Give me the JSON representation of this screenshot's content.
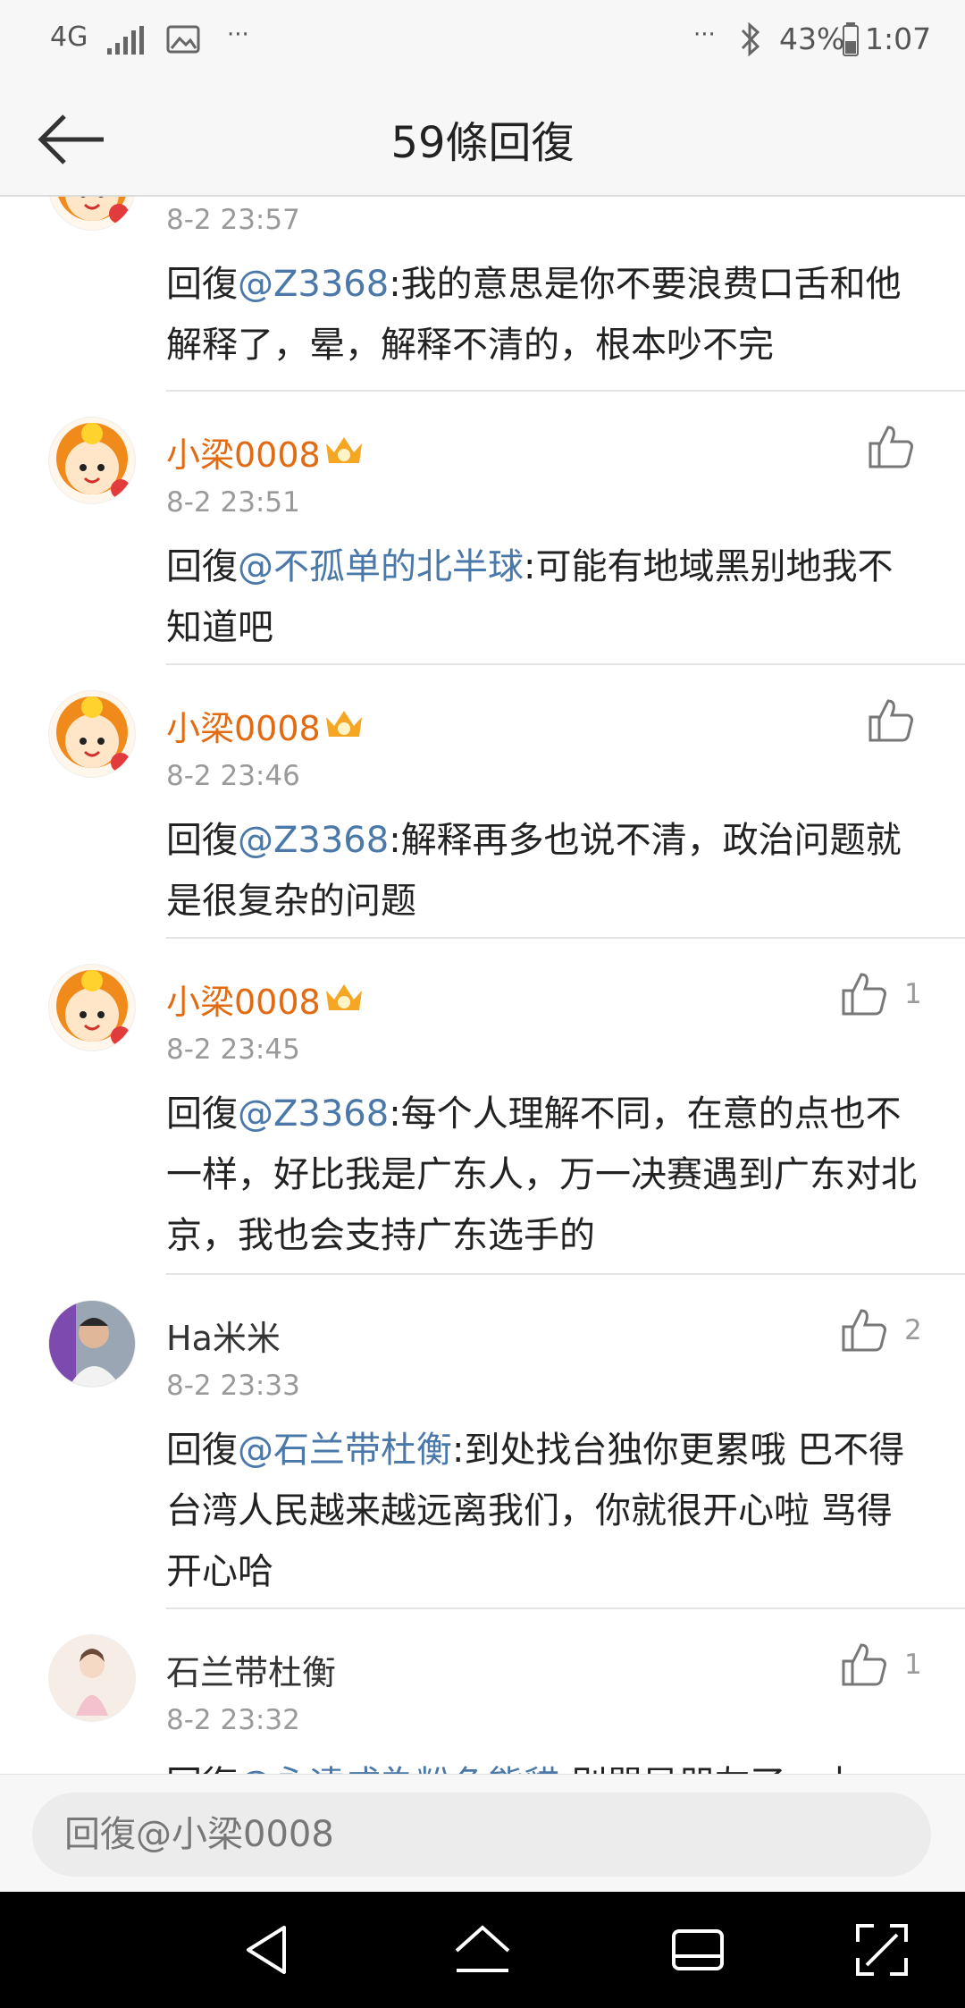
{
  "status_bar": {
    "network": "4G",
    "more_left": "···",
    "more_right": "···",
    "battery": "43%",
    "time": "1:07"
  },
  "header": {
    "title": "59條回復"
  },
  "comments": [
    {
      "username": "",
      "time": "8-2 23:57",
      "prefix": "回復",
      "mention": "@Z3368",
      "body": ":我的意思是你不要浪费口舌和他解释了，晕，解释不清的，根本吵不完",
      "likes": ""
    },
    {
      "username": "小梁0008",
      "time": "8-2 23:51",
      "prefix": "回復",
      "mention": "@不孤单的北半球",
      "body": ":可能有地域黑别地我不知道吧",
      "likes": ""
    },
    {
      "username": "小梁0008",
      "time": "8-2 23:46",
      "prefix": "回復",
      "mention": "@Z3368",
      "body": ":解释再多也说不清，政治问题就是很复杂的问题",
      "likes": ""
    },
    {
      "username": "小梁0008",
      "time": "8-2 23:45",
      "prefix": "回復",
      "mention": "@Z3368",
      "body": ":每个人理解不同，在意的点也不一样，好比我是广东人，万一决赛遇到广东对北京，我也会支持广东选手的",
      "likes": "1"
    },
    {
      "username": "Ha米米",
      "time": "8-2 23:33",
      "prefix": "回復",
      "mention": "@石兰带杜衡",
      "body": ":到处找台独你更累哦 巴不得台湾人民越来越远离我们，你就很开心啦 骂得开心哈",
      "likes": "2"
    },
    {
      "username": "石兰带杜衡",
      "time": "8-2 23:32",
      "prefix": "回復",
      "mention": "@永遠成為粉色熊貓",
      "body": ":别骂异朋友了，本",
      "likes": "1"
    }
  ],
  "composer": {
    "placeholder": "回復@小梁0008"
  },
  "colors": {
    "username_vip": "#e26a10",
    "mention": "#4a78a8",
    "timestamp": "#9a9a9a"
  }
}
